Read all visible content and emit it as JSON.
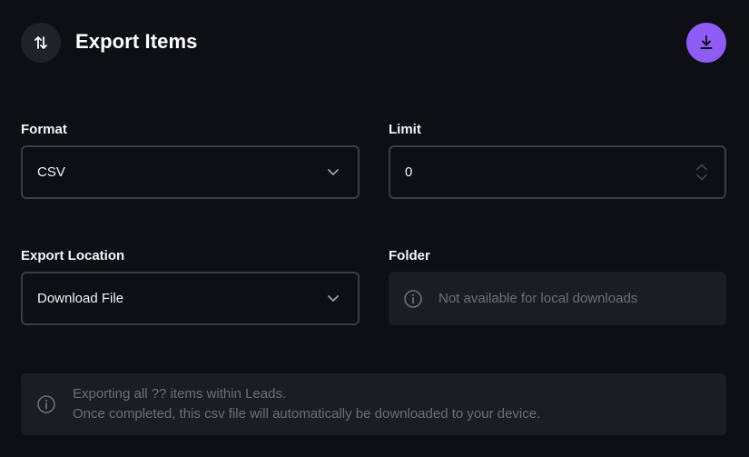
{
  "header": {
    "title": "Export Items",
    "title_icon": "arrows-up-down-icon",
    "action_icon": "download-icon"
  },
  "form": {
    "format": {
      "label": "Format",
      "value": "CSV",
      "icon": "chevron-down-icon"
    },
    "limit": {
      "label": "Limit",
      "value": "0",
      "icon": "stepper-icon"
    },
    "export_location": {
      "label": "Export Location",
      "value": "Download File",
      "icon": "chevron-down-icon"
    },
    "folder": {
      "label": "Folder",
      "message": "Not available for local downloads",
      "icon": "info-icon"
    }
  },
  "banner": {
    "line1": "Exporting all ?? items within Leads.",
    "line2": "Once completed, this csv file will automatically be downloaded to your device.",
    "icon": "info-icon"
  },
  "colors": {
    "background": "#0d0f15",
    "accent": "#8f5cf7",
    "panel": "#1a1d24",
    "border": "#3a3d45",
    "muted_text": "#6b6f78"
  }
}
